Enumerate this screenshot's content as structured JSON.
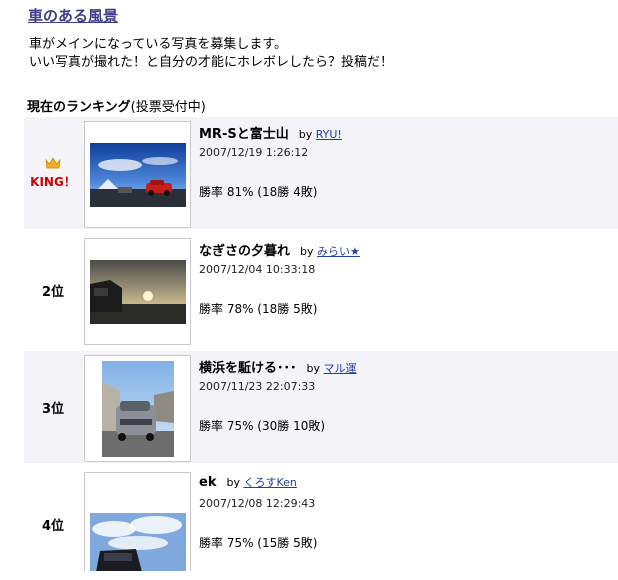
{
  "page": {
    "title": "車のある風景",
    "desc_line1": "車がメインになっている写真を募集します。",
    "desc_line2": "いい写真が撮れた！と自分の才能にホレボレしたら？投稿だ！",
    "ranking_heading": "現在のランキング",
    "ranking_sub": "(投票受付中)"
  },
  "entries": [
    {
      "rank": "KING！",
      "title": "MR-Sと富士山",
      "by": "by",
      "author": "RYU!",
      "date": "2007/12/19 1:26:12",
      "winrate": "勝率 81% (18勝 4敗)"
    },
    {
      "rank": "2位",
      "title": "なぎさの夕暮れ",
      "by": "by",
      "author": "みらい★",
      "date": "2007/12/04 10:33:18",
      "winrate": "勝率 78% (18勝 5敗)"
    },
    {
      "rank": "3位",
      "title": "横浜を駈ける･･･",
      "by": "by",
      "author": "マル運",
      "date": "2007/11/23 22:07:33",
      "winrate": "勝率 75% (30勝 10敗)"
    },
    {
      "rank": "4位",
      "title": "ek",
      "by": "by",
      "author": "くろすKen",
      "date": "2007/12/08 12:29:43",
      "winrate": "勝率 75% (15勝 5敗)"
    }
  ],
  "colors": {
    "title": "#3d3d8a",
    "king": "#cc0000",
    "link": "#1e3fa6",
    "row_alt": "#f3f3f8"
  },
  "icons": [
    "crown-icon"
  ]
}
